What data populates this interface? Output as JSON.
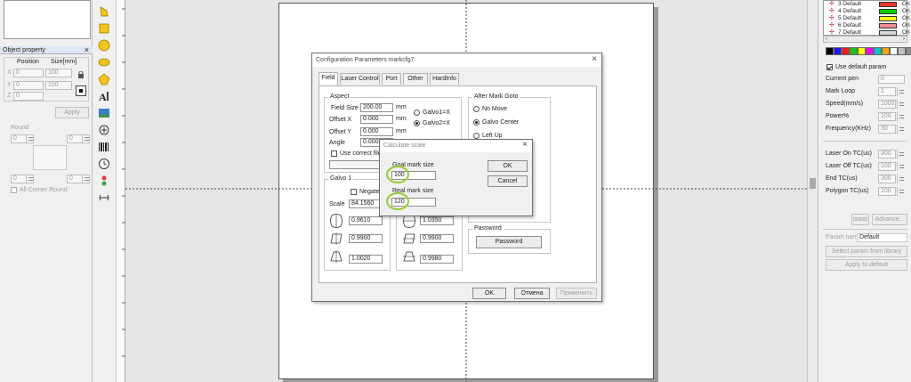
{
  "object_property": {
    "title": "Object property",
    "close_glyph": "×",
    "position_header": "Position",
    "size_header": "Size[mm]",
    "x_label": "X",
    "y_label": "Y",
    "z_label": "Z",
    "x_value": "0",
    "y_value": "0",
    "z_value": "0",
    "size_w": "100",
    "size_h": "100",
    "apply_label": "Apply",
    "round_label": "Round",
    "round_value_1": "0",
    "round_value_2": "0",
    "round_value_3": "0",
    "round_value_4": "0",
    "all_corner_round_label": "All Corner Round"
  },
  "layers": [
    {
      "name": "3 Default",
      "state": "On",
      "color": "#e8352b"
    },
    {
      "name": "4 Default",
      "state": "On",
      "color": "#00d200"
    },
    {
      "name": "5 Default",
      "state": "On",
      "color": "#ffff1a"
    },
    {
      "name": "6 Default",
      "state": "On",
      "color": "#f28c8c"
    },
    {
      "name": "7 Default",
      "state": "On",
      "color": "#d8d8d8"
    }
  ],
  "palette": [
    "#000000",
    "#1a1aff",
    "#ff1a1a",
    "#12c912",
    "#ffff00",
    "#ff00ff",
    "#00c8c8",
    "#f2a600",
    "#ffffff",
    "#c0c0c0",
    "#8a8a8a"
  ],
  "pen_params": {
    "use_default_label": "Use default param",
    "current_pen_label": "Current pen",
    "current_pen_value": "0",
    "mark_loop_label": "Mark Loop",
    "mark_loop_value": "1",
    "speed_label": "Speed(mm/s)",
    "speed_value": "1000",
    "power_label": "Power%",
    "power_value": "100",
    "freq_label": "Frequency(KHz)",
    "freq_value": "30",
    "laser_on_label": "Laser On TC(us)",
    "laser_on_value": "300",
    "laser_off_label": "Laser Off TC(us)",
    "laser_off_value": "100",
    "end_tc_label": "End TC(us)",
    "end_tc_value": "300",
    "polygon_tc_label": "Polygon TC(us)",
    "polygon_tc_value": "100",
    "gray_button": "αααα",
    "advance_label": "Advance...",
    "param_name_label": "Param name",
    "param_name_value": "Default",
    "select_library_label": "Select param from library",
    "apply_default_label": "Apply to default"
  },
  "config_dialog": {
    "title": "Configuration Parameters markcfg7",
    "tabs": [
      "Field",
      "Laser Control",
      "Port",
      "Other",
      "HardInfo"
    ],
    "aspect_title": "Aspect",
    "field_size_label": "Field Size",
    "field_size_value": "200.00",
    "offset_x_label": "Offset X",
    "offset_x_value": "0.000",
    "offset_y_label": "Offset Y",
    "offset_y_value": "0.000",
    "angle_label": "Angle",
    "angle_value": "0.000",
    "unit_mm": "mm",
    "galvo1_x": "Galvo1=X",
    "galvo2_x": "Galvo2=X",
    "use_correct_file": "Use correct file",
    "galvo1_title": "Galvo 1",
    "negate_label": "Negate",
    "scale_label": "Scale",
    "scale_value": "84.1560",
    "g1_v1": "0.9610",
    "g1_v2": "0.9900",
    "g1_v3": "1.0020",
    "g2_v1": "1.0350",
    "g2_v2": "0.9900",
    "g2_v3": "0.9980",
    "after_mark_title": "After Mark Goto",
    "no_move": "No Move",
    "galvo_center": "Galvo Center",
    "left_up": "Left Up",
    "password_title": "Password",
    "password_button": "Password",
    "ok": "OK",
    "cancel": "Отмена",
    "apply": "Применить"
  },
  "scale_dialog": {
    "title": "Calculate scale",
    "goal_label": "Goal mark size",
    "goal_value": "100",
    "real_label": "Real mark size",
    "real_value": "120",
    "ok": "OK",
    "cancel": "Cancel"
  }
}
